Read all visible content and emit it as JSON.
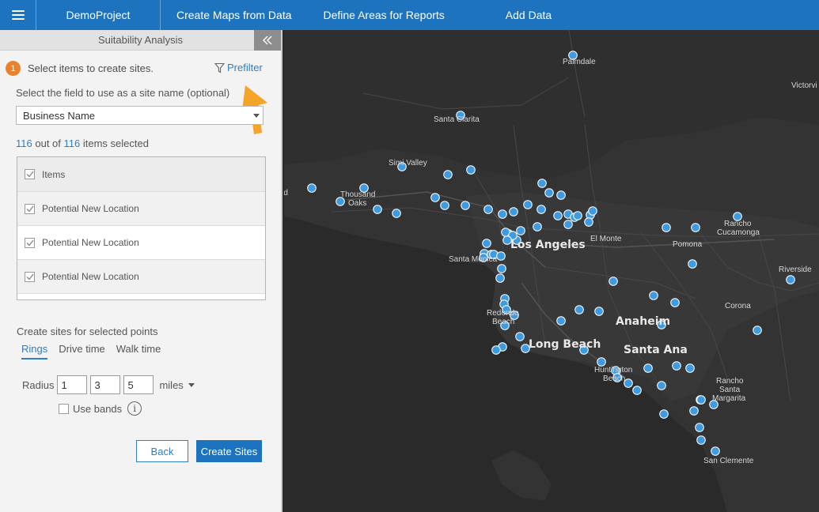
{
  "topbar": {
    "menu_icon": "hamburger-icon",
    "project": "DemoProject",
    "nav": [
      "Create Maps from Data",
      "Define Areas for Reports",
      "Add Data"
    ]
  },
  "panel": {
    "title": "Suitability Analysis",
    "collapse_icon": "double-chevron-left-icon",
    "step_number": "1",
    "step_text": "Select items to create sites.",
    "prefilter_label": "Prefilter",
    "field_label": "Select the field to use as a site name (optional)",
    "field_value": "Business Name",
    "count_selected": "116",
    "count_mid": "out of",
    "count_total": "116",
    "count_suffix": "items selected",
    "list_header": "Items",
    "list_items": [
      "Potential New Location",
      "Potential New Location",
      "Potential New Location"
    ],
    "sites_label": "Create sites for selected points",
    "tabs": [
      "Rings",
      "Drive time",
      "Walk time"
    ],
    "active_tab": "Rings",
    "radius_label": "Radius",
    "radius_values": [
      "1",
      "3",
      "5"
    ],
    "units": "miles",
    "use_bands_label": "Use bands",
    "info_icon": "info-icon",
    "back_label": "Back",
    "create_label": "Create Sites"
  },
  "colors": {
    "topbar": "#1e73be",
    "accent": "#2e7fc3",
    "step_badge": "#e9812d",
    "annotation_arrow": "#f5a42a",
    "map_background": "#2a2a2a",
    "site_point": "#3f9be0"
  },
  "map": {
    "cities": [
      "Palmdale",
      "Victorvi",
      "Santa Clarita",
      "Simi Valley",
      "Thousand",
      "Oaks",
      "rd",
      "Los Angeles",
      "Santa Monica",
      "El Monte",
      "Pomona",
      "Rancho",
      "Cucamonga",
      "Riverside",
      "Corona",
      "Redondo",
      "Beach",
      "Long Beach",
      "Anaheim",
      "Santa Ana",
      "Huntington",
      "Beach",
      "Rancho",
      "Santa",
      "Margarita",
      "San Clemente"
    ]
  }
}
